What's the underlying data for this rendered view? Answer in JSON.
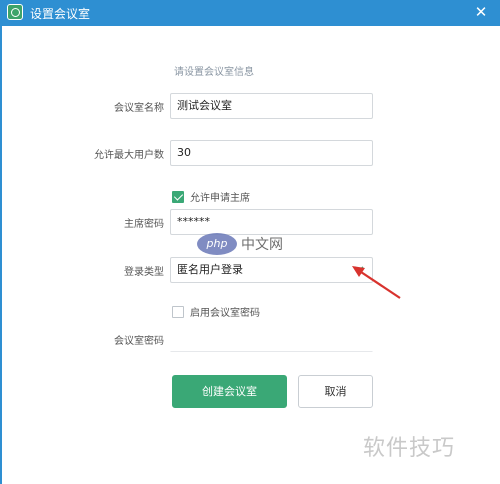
{
  "window": {
    "title": "设置会议室",
    "close_glyph": "✕"
  },
  "form": {
    "hint": "请设置会议室信息",
    "room_name": {
      "label": "会议室名称",
      "value": "测试会议室"
    },
    "max_users": {
      "label": "允许最大用户数",
      "value": "30"
    },
    "allow_chair": {
      "label": "允许申请主席",
      "checked": true
    },
    "chair_password": {
      "label": "主席密码",
      "value": "******"
    },
    "login_type": {
      "label": "登录类型",
      "value": "匿名用户登录"
    },
    "enable_room_password": {
      "label": "启用会议室密码",
      "checked": false
    },
    "room_password": {
      "label": "会议室密码",
      "value": ""
    }
  },
  "buttons": {
    "create": "创建会议室",
    "cancel": "取消"
  },
  "overlay": {
    "php_logo": "php",
    "php_text": "中文网",
    "watermark": "软件技巧"
  },
  "colors": {
    "titlebar": "#2e8fd2",
    "accent_green": "#3aa876",
    "annotation_red": "#d8332e"
  },
  "icons": {
    "app": "app-icon",
    "close": "close-icon",
    "dropdown": "chevron-down-icon"
  }
}
